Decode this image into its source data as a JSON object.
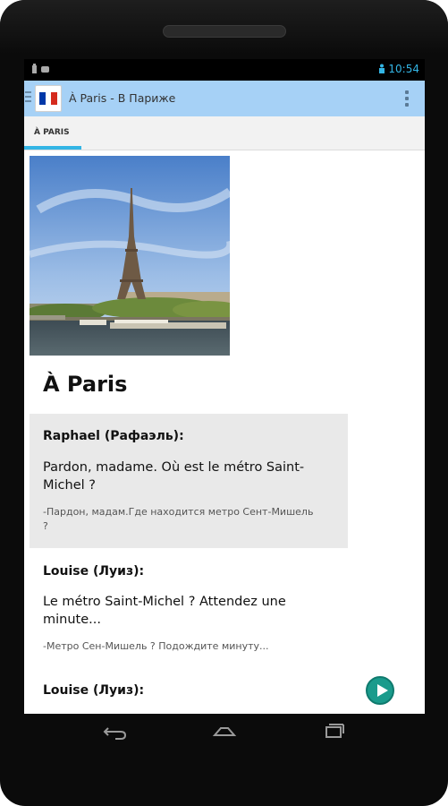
{
  "status_bar": {
    "time": "10:54"
  },
  "action_bar": {
    "title": "À Paris - В Париже"
  },
  "tabs": [
    {
      "label": "À PARIS",
      "selected": true
    }
  ],
  "lesson": {
    "heading": "À Paris",
    "dialogue": [
      {
        "speaker": "Raphael (Рафаэль):",
        "french": "Pardon, madame. Où est le métro Saint-Michel ?",
        "russian": "-Пардон, мадам.Где находится метро Сент-Мишель ?",
        "highlighted": true
      },
      {
        "speaker": "Louise (Луиз):",
        "french": "Le métro Saint-Michel ? Attendez une minute...",
        "russian": "-Метро Сен-Мишель ? Подождите минуту...",
        "highlighted": false
      },
      {
        "speaker": "Louise (Луиз):",
        "french": "",
        "russian": "",
        "highlighted": false
      }
    ]
  },
  "colors": {
    "action_bar": "#a6d1f6",
    "tab_indicator": "#33b5e5",
    "play_button": "#1a9b8c",
    "highlight_block": "#e9e9e9"
  },
  "icons": {
    "app_icon": "french-flag-icon",
    "menu": "overflow-menu-icon",
    "play": "play-icon",
    "nav_back": "back-icon",
    "nav_home": "home-icon",
    "nav_recent": "recent-apps-icon"
  }
}
